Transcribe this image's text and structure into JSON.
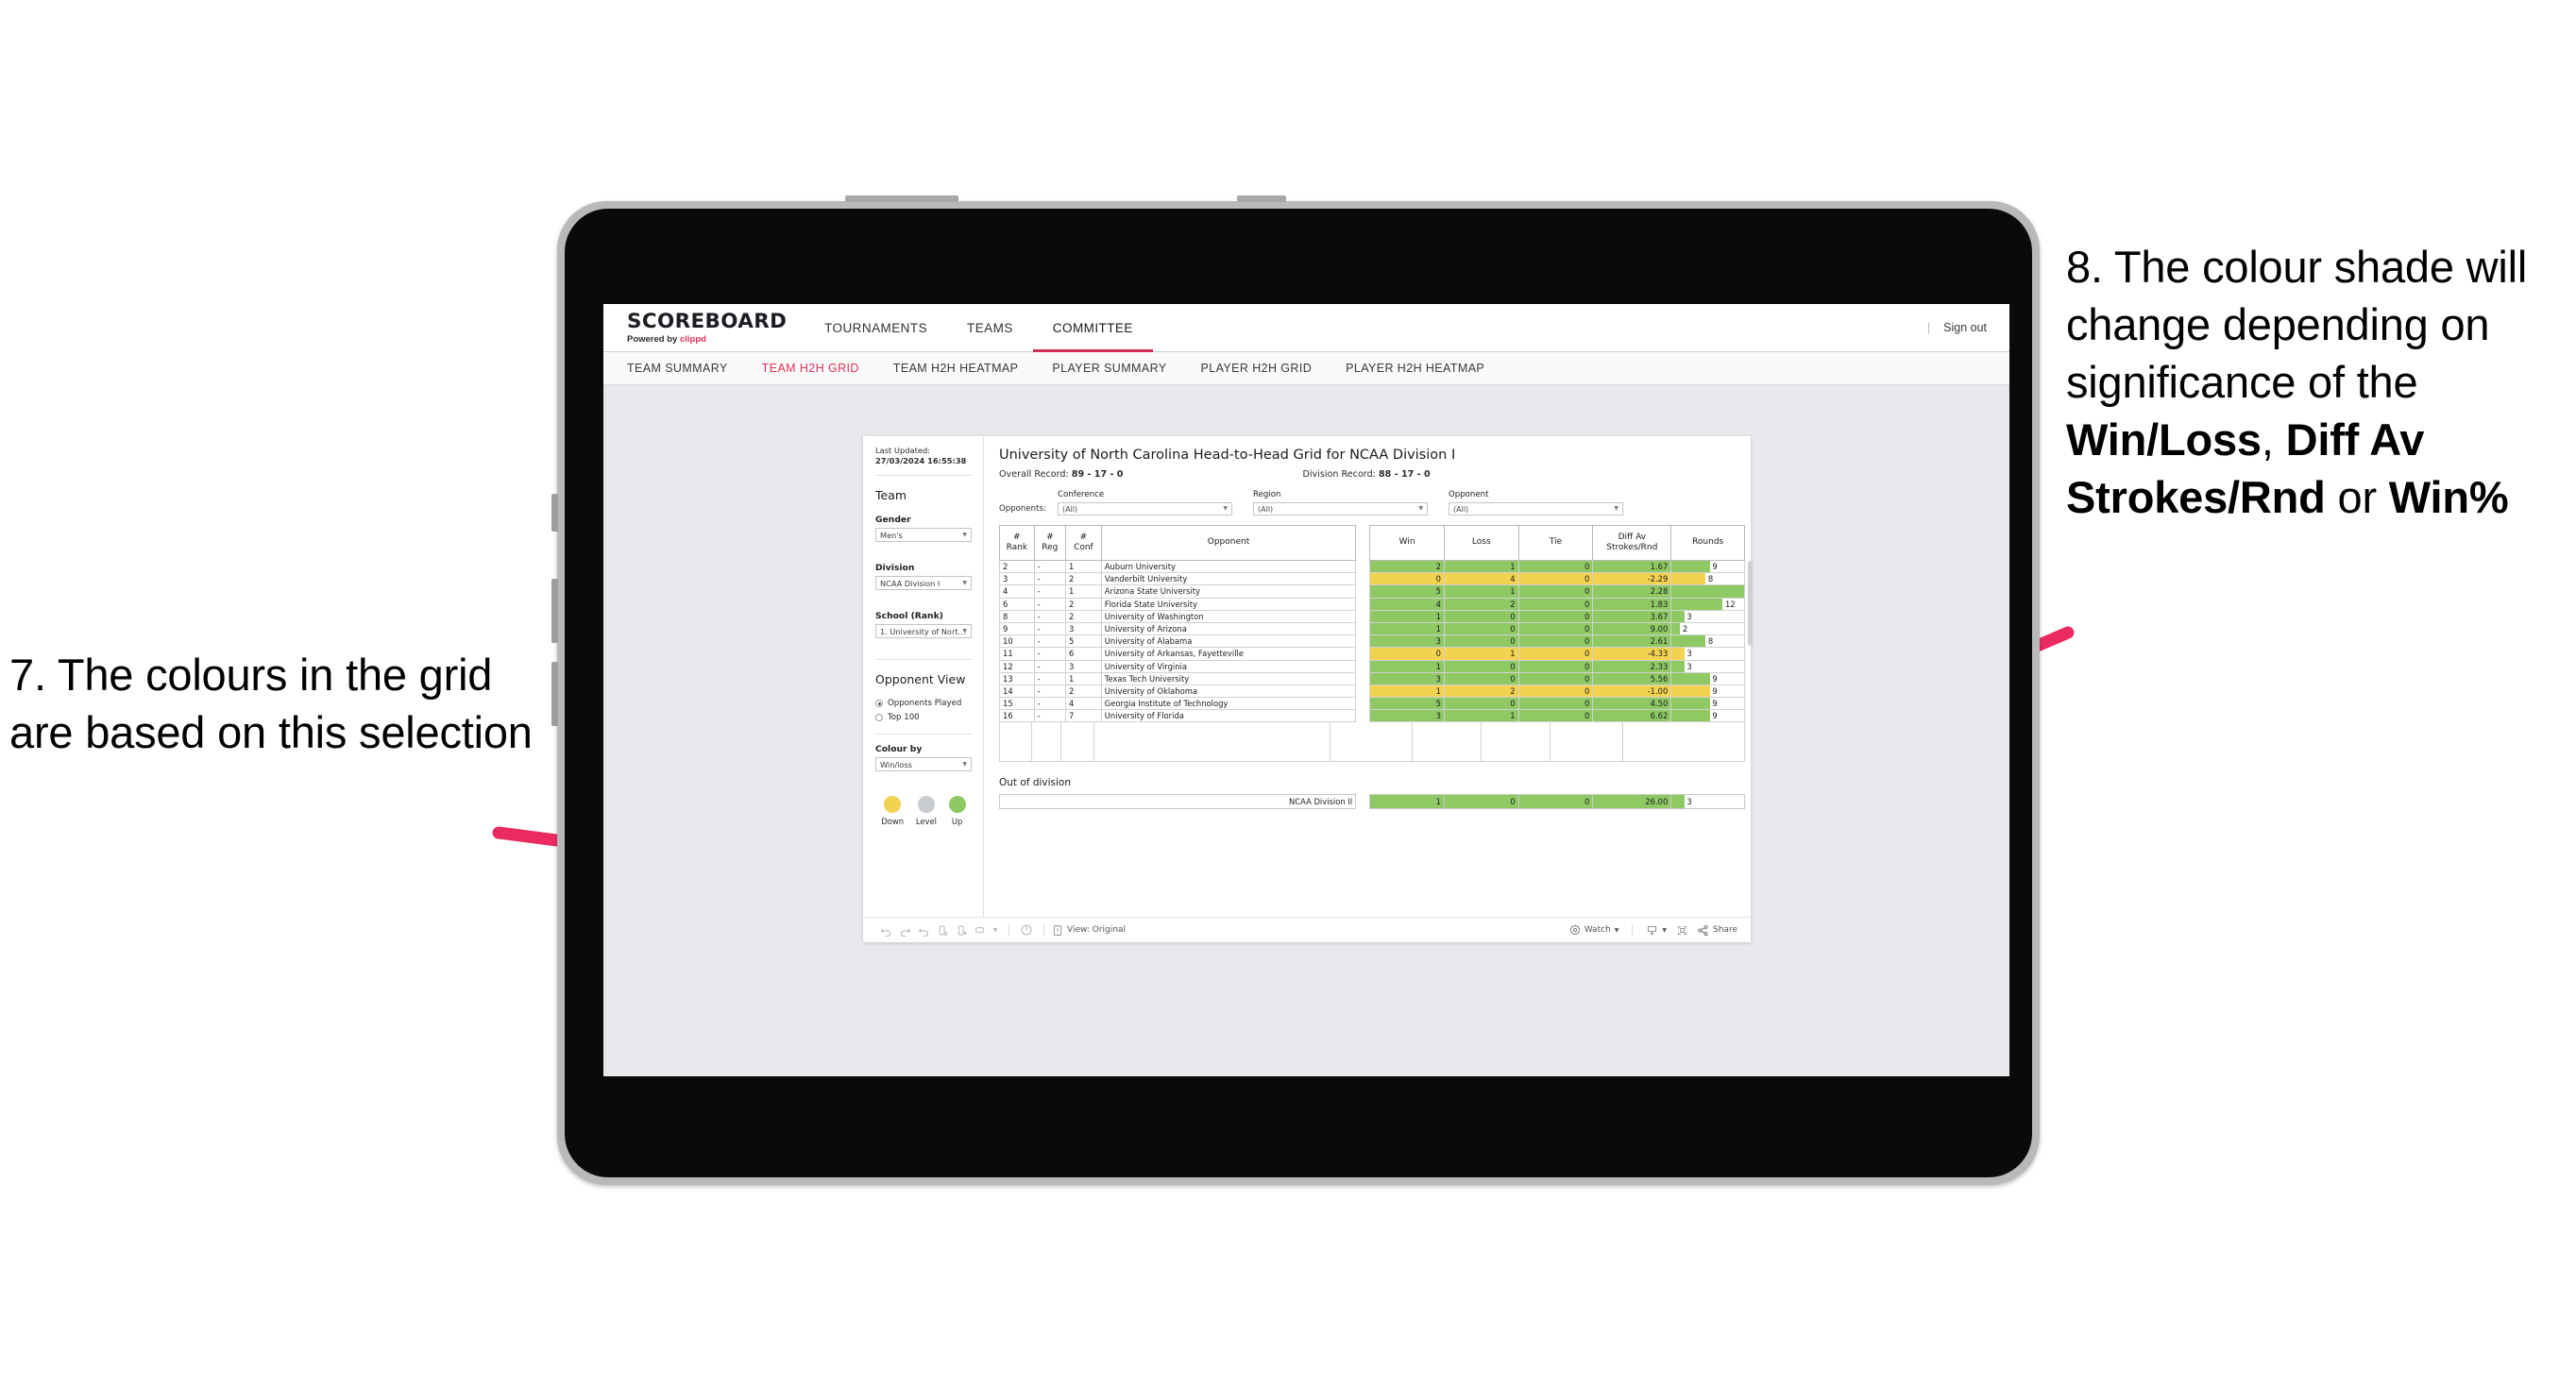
{
  "annotations": {
    "left": {
      "number": "7.",
      "text": "The colours in the grid are based on this selection"
    },
    "right": {
      "number": "8.",
      "line1": "The colour shade will change depending on significance of the ",
      "bold1": "Win/Loss",
      "mid1": ", ",
      "bold2": "Diff Av Strokes/Rnd",
      "mid2": " or ",
      "bold3": "Win%"
    }
  },
  "app": {
    "brand": {
      "title": "SCOREBOARD",
      "powered_prefix": "Powered by ",
      "powered_accent": "clippd"
    },
    "topnav": {
      "items": [
        {
          "label": "TOURNAMENTS",
          "active": false
        },
        {
          "label": "TEAMS",
          "active": false
        },
        {
          "label": "COMMITTEE",
          "active": true
        }
      ],
      "divider": "|",
      "sign_out": "Sign out"
    },
    "subnav": {
      "items": [
        {
          "label": "TEAM SUMMARY",
          "active": false
        },
        {
          "label": "TEAM H2H GRID",
          "active": true
        },
        {
          "label": "TEAM H2H HEATMAP",
          "active": false
        },
        {
          "label": "PLAYER SUMMARY",
          "active": false
        },
        {
          "label": "PLAYER H2H GRID",
          "active": false
        },
        {
          "label": "PLAYER H2H HEATMAP",
          "active": false
        }
      ]
    }
  },
  "sidebar": {
    "last_updated_label": "Last Updated: ",
    "last_updated_value": "27/03/2024 16:55:38",
    "team_heading": "Team",
    "gender": {
      "label": "Gender",
      "value": "Men's"
    },
    "division": {
      "label": "Division",
      "value": "NCAA Division I"
    },
    "school": {
      "label": "School (Rank)",
      "value": "1. University of Nort..."
    },
    "opponent_view": {
      "heading": "Opponent View",
      "options": [
        {
          "label": "Opponents Played",
          "selected": true
        },
        {
          "label": "Top 100",
          "selected": false
        }
      ]
    },
    "colour_by": {
      "label": "Colour by",
      "value": "Win/loss"
    },
    "legend": [
      {
        "label": "Down",
        "color": "#f2d24f"
      },
      {
        "label": "Level",
        "color": "#c9ccd1"
      },
      {
        "label": "Up",
        "color": "#8dc963"
      }
    ]
  },
  "main": {
    "title": "University of North Carolina Head-to-Head Grid for NCAA Division I",
    "overall_record_label": "Overall Record: ",
    "overall_record_value": "89 - 17 - 0",
    "division_record_label": "Division Record: ",
    "division_record_value": "88 - 17 - 0",
    "opponents_label": "Opponents:",
    "opponent_filters": [
      {
        "label": "Conference",
        "value": "(All)"
      },
      {
        "label": "Region",
        "value": "(All)"
      },
      {
        "label": "Opponent",
        "value": "(All)"
      }
    ],
    "out_of_division_title": "Out of division"
  },
  "chart_data": {
    "type": "table",
    "title": "University of North Carolina Head-to-Head Grid for NCAA Division I",
    "columns": [
      "# Rank",
      "# Reg",
      "# Conf",
      "Opponent",
      "Win",
      "Loss",
      "Tie",
      "Diff Av Strokes/Rnd",
      "Rounds"
    ],
    "column_headers_multiline": [
      {
        "l1": "#",
        "l2": "Rank"
      },
      {
        "l1": "#",
        "l2": "Reg"
      },
      {
        "l1": "#",
        "l2": "Conf"
      },
      {
        "l1": "",
        "l2": "Opponent"
      },
      {
        "l1": "",
        "l2": "Win"
      },
      {
        "l1": "",
        "l2": "Loss"
      },
      {
        "l1": "",
        "l2": "Tie"
      },
      {
        "l1": "Diff Av",
        "l2": "Strokes/Rnd"
      },
      {
        "l1": "",
        "l2": "Rounds"
      }
    ],
    "rounds_max": 17,
    "rows": [
      {
        "rank": "2",
        "reg": "-",
        "conf": "1",
        "opponent": "Auburn University",
        "win": "2",
        "loss": "1",
        "tie": "0",
        "diff": "1.67",
        "rounds": "9",
        "color": "green"
      },
      {
        "rank": "3",
        "reg": "-",
        "conf": "2",
        "opponent": "Vanderbilt University",
        "win": "0",
        "loss": "4",
        "tie": "0",
        "diff": "-2.29",
        "rounds": "8",
        "color": "yellow"
      },
      {
        "rank": "4",
        "reg": "-",
        "conf": "1",
        "opponent": "Arizona State University",
        "win": "5",
        "loss": "1",
        "tie": "0",
        "diff": "2.28",
        "rounds": "17",
        "color": "green"
      },
      {
        "rank": "6",
        "reg": "-",
        "conf": "2",
        "opponent": "Florida State University",
        "win": "4",
        "loss": "2",
        "tie": "0",
        "diff": "1.83",
        "rounds": "12",
        "color": "green"
      },
      {
        "rank": "8",
        "reg": "-",
        "conf": "2",
        "opponent": "University of Washington",
        "win": "1",
        "loss": "0",
        "tie": "0",
        "diff": "3.67",
        "rounds": "3",
        "color": "green"
      },
      {
        "rank": "9",
        "reg": "-",
        "conf": "3",
        "opponent": "University of Arizona",
        "win": "1",
        "loss": "0",
        "tie": "0",
        "diff": "9.00",
        "rounds": "2",
        "color": "green"
      },
      {
        "rank": "10",
        "reg": "-",
        "conf": "5",
        "opponent": "University of Alabama",
        "win": "3",
        "loss": "0",
        "tie": "0",
        "diff": "2.61",
        "rounds": "8",
        "color": "green"
      },
      {
        "rank": "11",
        "reg": "-",
        "conf": "6",
        "opponent": "University of Arkansas, Fayetteville",
        "win": "0",
        "loss": "1",
        "tie": "0",
        "diff": "-4.33",
        "rounds": "3",
        "color": "yellow"
      },
      {
        "rank": "12",
        "reg": "-",
        "conf": "3",
        "opponent": "University of Virginia",
        "win": "1",
        "loss": "0",
        "tie": "0",
        "diff": "2.33",
        "rounds": "3",
        "color": "green"
      },
      {
        "rank": "13",
        "reg": "-",
        "conf": "1",
        "opponent": "Texas Tech University",
        "win": "3",
        "loss": "0",
        "tie": "0",
        "diff": "5.56",
        "rounds": "9",
        "color": "green"
      },
      {
        "rank": "14",
        "reg": "-",
        "conf": "2",
        "opponent": "University of Oklahoma",
        "win": "1",
        "loss": "2",
        "tie": "0",
        "diff": "-1.00",
        "rounds": "9",
        "color": "yellow"
      },
      {
        "rank": "15",
        "reg": "-",
        "conf": "4",
        "opponent": "Georgia Institute of Technology",
        "win": "5",
        "loss": "0",
        "tie": "0",
        "diff": "4.50",
        "rounds": "9",
        "color": "green"
      },
      {
        "rank": "16",
        "reg": "-",
        "conf": "7",
        "opponent": "University of Florida",
        "win": "3",
        "loss": "1",
        "tie": "0",
        "diff": "6.62",
        "rounds": "9",
        "color": "green"
      }
    ],
    "out_of_division": [
      {
        "opponent": "NCAA Division II",
        "win": "1",
        "loss": "0",
        "tie": "0",
        "diff": "26.00",
        "rounds": "3",
        "color": "green"
      }
    ]
  },
  "toolbar": {
    "view_label": "View: Original",
    "watch_label": "Watch",
    "share_label": "Share",
    "icons": [
      "undo-icon",
      "redo-icon",
      "revert-icon",
      "refresh-data-icon",
      "pause-auto-update-icon",
      "alerts-icon",
      "device-preview-icon",
      "share-icon"
    ]
  }
}
